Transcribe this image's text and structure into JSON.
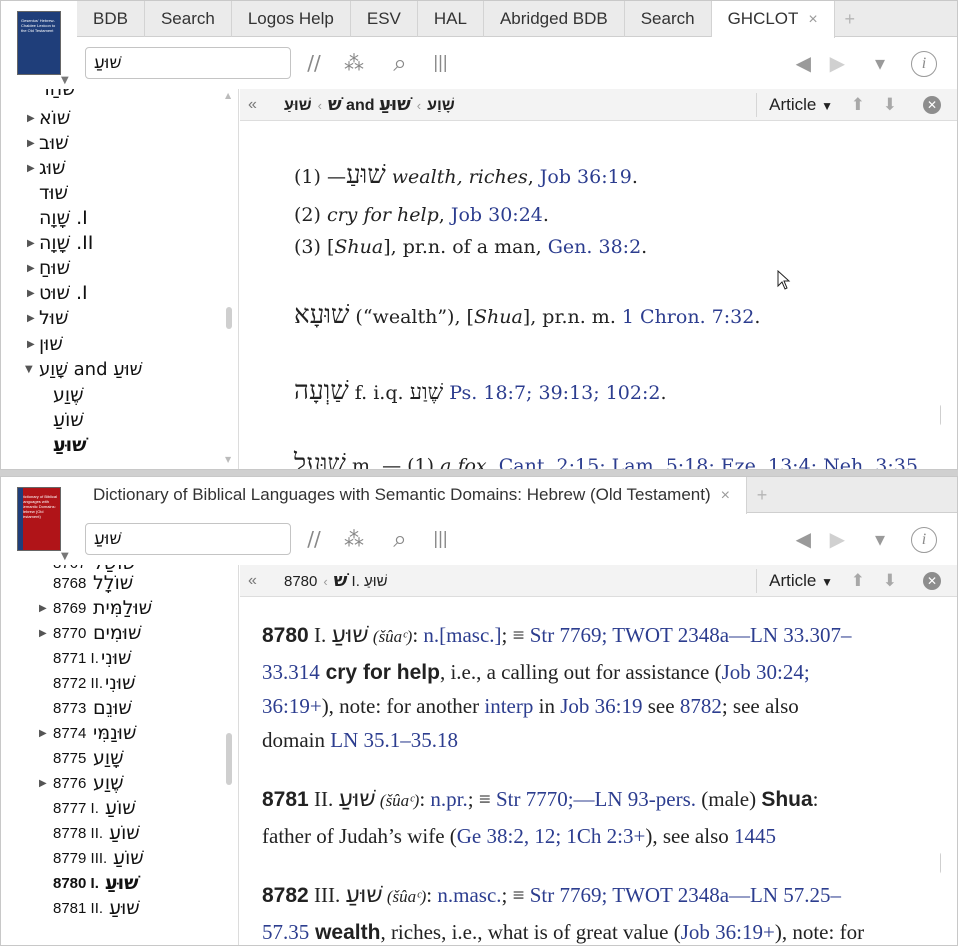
{
  "pane1": {
    "cover_title": "Gesenius' Hebrew-Chaldee Lexicon to the Old Testament",
    "tabs": [
      "BDB",
      "Search",
      "Logos Help",
      "ESV",
      "HAL",
      "Abridged BDB",
      "Search",
      "GHCLOT"
    ],
    "active_tab_close": "×",
    "tab_plus": "+",
    "search_value": "שׁוּעַ",
    "toc": [
      {
        "label": "שֹׁחַר",
        "tri": ""
      },
      {
        "label": "שׁוֹא",
        "tri": "▶"
      },
      {
        "label": "שׁוּב",
        "tri": "▶"
      },
      {
        "label": "שׁוּג",
        "tri": "▶"
      },
      {
        "label": "שׁוּד",
        "tri": ""
      },
      {
        "label": "I. שָׁוָה",
        "tri": ""
      },
      {
        "label": "II. שָׁוָה",
        "tri": "▶"
      },
      {
        "label": "שׁוּחַ",
        "tri": "▶"
      },
      {
        "label": "I. שׁוּט",
        "tri": "▶"
      },
      {
        "label": "שׁוּל",
        "tri": "▶"
      },
      {
        "label": "שׁוּן",
        "tri": "▶"
      },
      {
        "label": "שׁוּעַ and שָׁוַע",
        "tri": "▼"
      },
      {
        "label": "שֶׁוַע",
        "tri": ""
      },
      {
        "label": "שׁוֹעַ",
        "tri": ""
      },
      {
        "label": "שׁוּעַ",
        "tri": ""
      }
    ],
    "breadcrumb": [
      "שׁ",
      "שׁוּעַ and שָׁוַע",
      "שׁוּעַ"
    ],
    "article_label": "Article",
    "lines": [
      {
        "hw": "שׁוּעַ",
        "rest_pre": "— (1) ",
        "it": "wealth, riches",
        "sep": ", ",
        "ref": "Job 36:19",
        "end": "."
      },
      {
        "pre": "(2) ",
        "it": "cry for help",
        "sep": ", ",
        "ref": "Job 30:24",
        "end": "."
      },
      {
        "pre": "(3) [",
        "it": "Shua",
        "mid": "], pr.n. of a man, ",
        "ref": "Gen. 38:2",
        "end": "."
      },
      {
        "hw": "שׁוּעָא",
        "mid1": " (“wealth”), [",
        "it": "Shua",
        "mid2": "], pr.n. m. ",
        "ref": "1 Chron. 7:32",
        "end": "."
      },
      {
        "hw": "שַׁוְעָה",
        "mid1": " f. i.q. ",
        "hw2": "שֶׁוַע",
        "ref": "Ps. 18:7; 39:13; 102:2",
        "end": "."
      },
      {
        "hw": "שׁוּעָל",
        "mid1": " m. — (1) ",
        "it": "a fox",
        "ref": "Cant. 2:15; Lam. 5:18; Eze. 13:4; Neh. 3:35"
      }
    ]
  },
  "pane2": {
    "cover_title": "Dictionary of Biblical Languages with Semantic Domains: Hebrew (Old Testament)",
    "tab": "Dictionary of Biblical Languages with Semantic Domains: Hebrew (Old Testament)",
    "tab_close": "×",
    "tab_plus": "+",
    "search_value": "שׁוּעַ",
    "toc": [
      {
        "num": "8767",
        "heb": "שׁוּשַׁל",
        "tri": ""
      },
      {
        "num": "8768",
        "heb": "שׁוֹלָל",
        "tri": ""
      },
      {
        "num": "8769",
        "heb": "שׁוּלַמִּית",
        "tri": "▶"
      },
      {
        "num": "8770",
        "heb": "שׁוּמִים",
        "tri": "▶"
      },
      {
        "num": "8771 I.",
        "heb": "שׁוּנִי",
        "tri": ""
      },
      {
        "num": "8772 II.",
        "heb": "שׁוּנִי",
        "tri": ""
      },
      {
        "num": "8773",
        "heb": "שׁוּנֵם",
        "tri": ""
      },
      {
        "num": "8774",
        "heb": "שׁוּנַמִּי",
        "tri": "▶"
      },
      {
        "num": "8775",
        "heb": "שָׁוַע",
        "tri": ""
      },
      {
        "num": "8776",
        "heb": "שֶׁוַע",
        "tri": "▶"
      },
      {
        "num": "8777 I.",
        "heb": "שׁוֹעַ",
        "tri": ""
      },
      {
        "num": "8778 II.",
        "heb": "שׁוֹעַ",
        "tri": ""
      },
      {
        "num": "8779 III.",
        "heb": "שׁוֹעַ",
        "tri": ""
      },
      {
        "num": "8780 I.",
        "heb": "שׁוּעַ",
        "tri": "",
        "bold": true
      },
      {
        "num": "8781 II.",
        "heb": "שׁוּעַ",
        "tri": ""
      }
    ],
    "breadcrumb": [
      "שׁ",
      "8780 I. שׁוּעַ"
    ],
    "article_label": "Article",
    "entries": {
      "l1": {
        "n": "8780",
        "rn": " I. ",
        "hw": "שׁוּעַ",
        "tr": " (šûaᶜ)",
        "t1": ": ",
        "r1": "n.[masc.]",
        "t2": "; ≡ ",
        "r2": "Str 7769; TWOT 2348a—LN 33.307–"
      },
      "l2": {
        "r1": "33.314",
        "g": " cry for help",
        "t1": ", i.e., a calling out for assistance (",
        "r2": "Job 30:24;"
      },
      "l3": {
        "r1": "36:19+",
        "t1": "), note: for another ",
        "r2": "interp",
        "t2": " in ",
        "r3": "Job 36:19",
        "t3": " see ",
        "r4": "8782",
        "t4": "; see also"
      },
      "l4": {
        "t1": "domain ",
        "r1": "LN 35.1–35.18"
      },
      "l5": {
        "n": "8781",
        "rn": " II. ",
        "hw": "שׁוּעַ",
        "tr": " (šûaᶜ)",
        "t1": ": ",
        "r1": "n.pr.",
        "t2": "; ≡ ",
        "r2": "Str 7770;—LN 93-pers.",
        "t3": " (male) ",
        "g": "Shua",
        "t4": ":"
      },
      "l6": {
        "t1": "father of Judah’s wife (",
        "r1": "Ge 38:2, 12; 1Ch 2:3+",
        "t2": "), see also ",
        "r2": "1445"
      },
      "l7": {
        "n": "8782",
        "rn": " III. ",
        "hw": "שׁוּעַ",
        "tr": " (šûaᶜ)",
        "t1": ": ",
        "r1": "n.masc.",
        "t2": "; ≡ ",
        "r2": "Str 7769; TWOT 2348a—LN 57.25–"
      },
      "l8": {
        "r1": "57.35",
        "g": " wealth",
        "t1": ", riches, i.e., what is of great value (",
        "r2": "Job 36:19+",
        "t2": "), note: for"
      }
    }
  },
  "icons": {
    "parallel": "//",
    "dots": "⁂",
    "search": "⌕",
    "columns": "|||",
    "back": "◀",
    "forward": "▶",
    "dropdown": "▾",
    "info": "i"
  },
  "colors": {
    "link": "#2c3d8f",
    "cover1": "#1f3e7a",
    "cover2": "#b01418"
  }
}
